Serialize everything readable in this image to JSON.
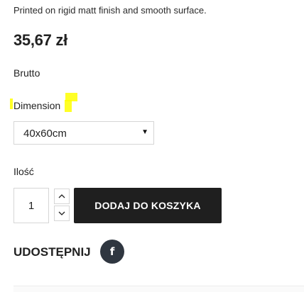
{
  "product": {
    "description": "Printed on rigid matt finish and smooth surface.",
    "price": "35,67 zł",
    "tax_label": "Brutto"
  },
  "variant": {
    "label": "Dimension",
    "selected": "40x60cm"
  },
  "quantity": {
    "label": "Ilość",
    "value": "1"
  },
  "cart": {
    "add_label": "DODAJ DO KOSZYKA"
  },
  "share": {
    "title": "UDOSTĘPNIJ",
    "facebook_glyph": "f",
    "facebook_icon": "facebook-icon"
  },
  "colors": {
    "button_bg": "#1f1f1f",
    "social_bg": "#2f3640",
    "highlight": "#ffff00"
  }
}
